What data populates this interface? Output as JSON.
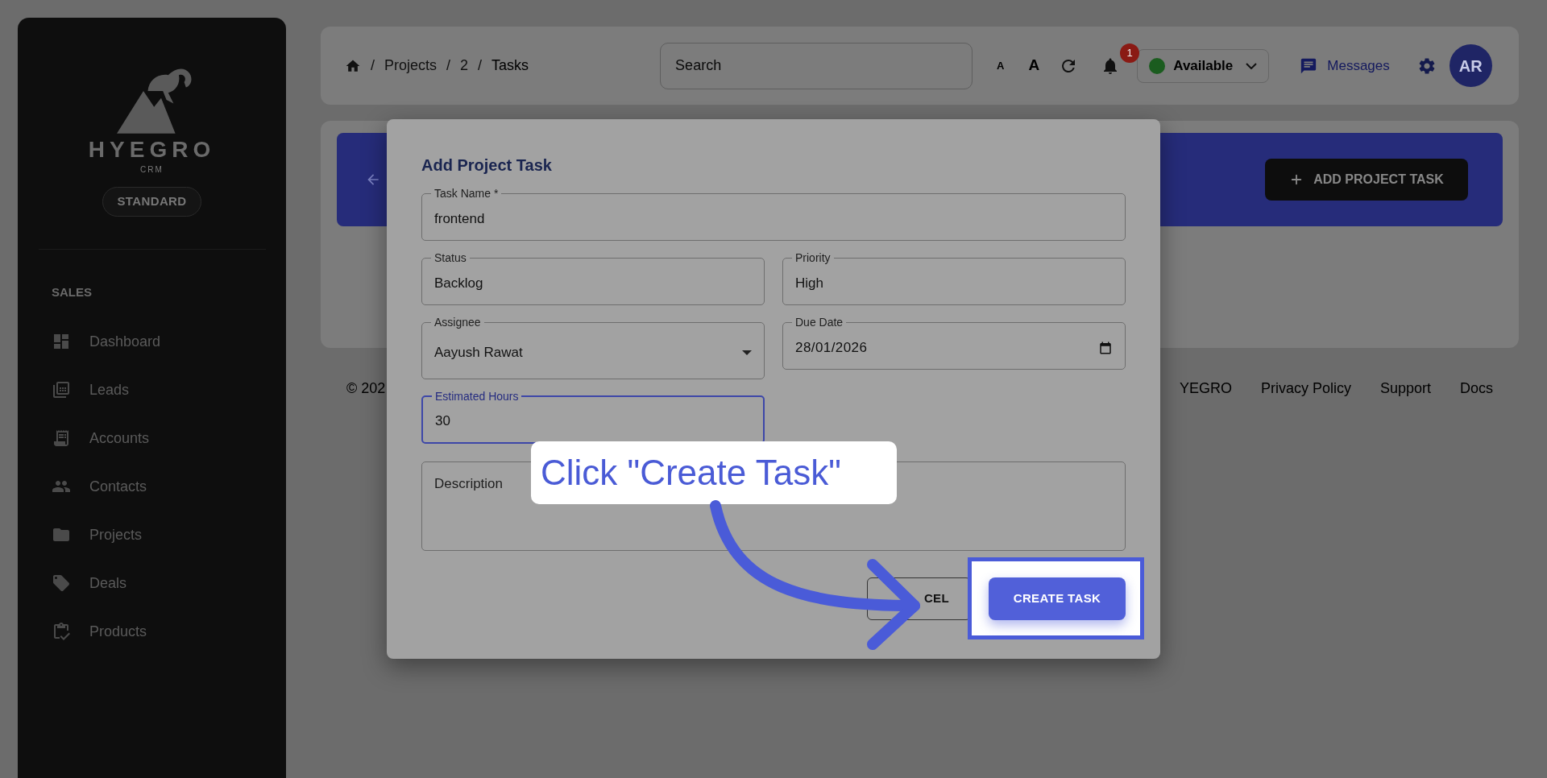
{
  "sidebar": {
    "brand": "HYEGRO",
    "tagline": "CRM",
    "plan_badge": "STANDARD",
    "section": "SALES",
    "items": [
      {
        "label": "Dashboard"
      },
      {
        "label": "Leads"
      },
      {
        "label": "Accounts"
      },
      {
        "label": "Contacts"
      },
      {
        "label": "Projects"
      },
      {
        "label": "Deals"
      },
      {
        "label": "Products"
      }
    ]
  },
  "header": {
    "separator": "/",
    "breadcrumb": [
      "Projects",
      "2",
      "Tasks"
    ],
    "search": {
      "placeholder": "Search"
    },
    "font_small": "A",
    "font_large": "A",
    "notifications": "1",
    "status": "Available",
    "messages": "Messages",
    "avatar": "AR"
  },
  "page": {
    "add_button": "ADD PROJECT TASK"
  },
  "footer": {
    "copyright": "© 202",
    "links": [
      "YEGRO",
      "Privacy Policy",
      "Support",
      "Docs"
    ]
  },
  "dialog": {
    "title": "Add Project Task",
    "rows": [
      {
        "fields": [
          {
            "kind": "text",
            "label": "Task Name *",
            "value": "frontend",
            "focused": false
          }
        ]
      },
      {
        "fields": [
          {
            "kind": "text",
            "label": "Status",
            "value": "Backlog",
            "focused": false
          },
          {
            "kind": "text",
            "label": "Priority",
            "value": "High",
            "focused": false
          }
        ]
      },
      {
        "fields": [
          {
            "kind": "select",
            "label": "Assignee",
            "value": "Aayush Rawat",
            "focused": false
          },
          {
            "kind": "date",
            "label": "Due Date",
            "value": "28/01/2026",
            "focused": false
          }
        ]
      },
      {
        "fields": [
          {
            "kind": "text",
            "label": "Estimated Hours",
            "value": "30",
            "focused": true
          }
        ]
      },
      {
        "fields": [
          {
            "kind": "textarea",
            "placeholder": "Description",
            "focused": false
          }
        ]
      }
    ],
    "cancel": "CEL",
    "submit": "CREATE TASK"
  },
  "callout": "Click \"Create Task\""
}
